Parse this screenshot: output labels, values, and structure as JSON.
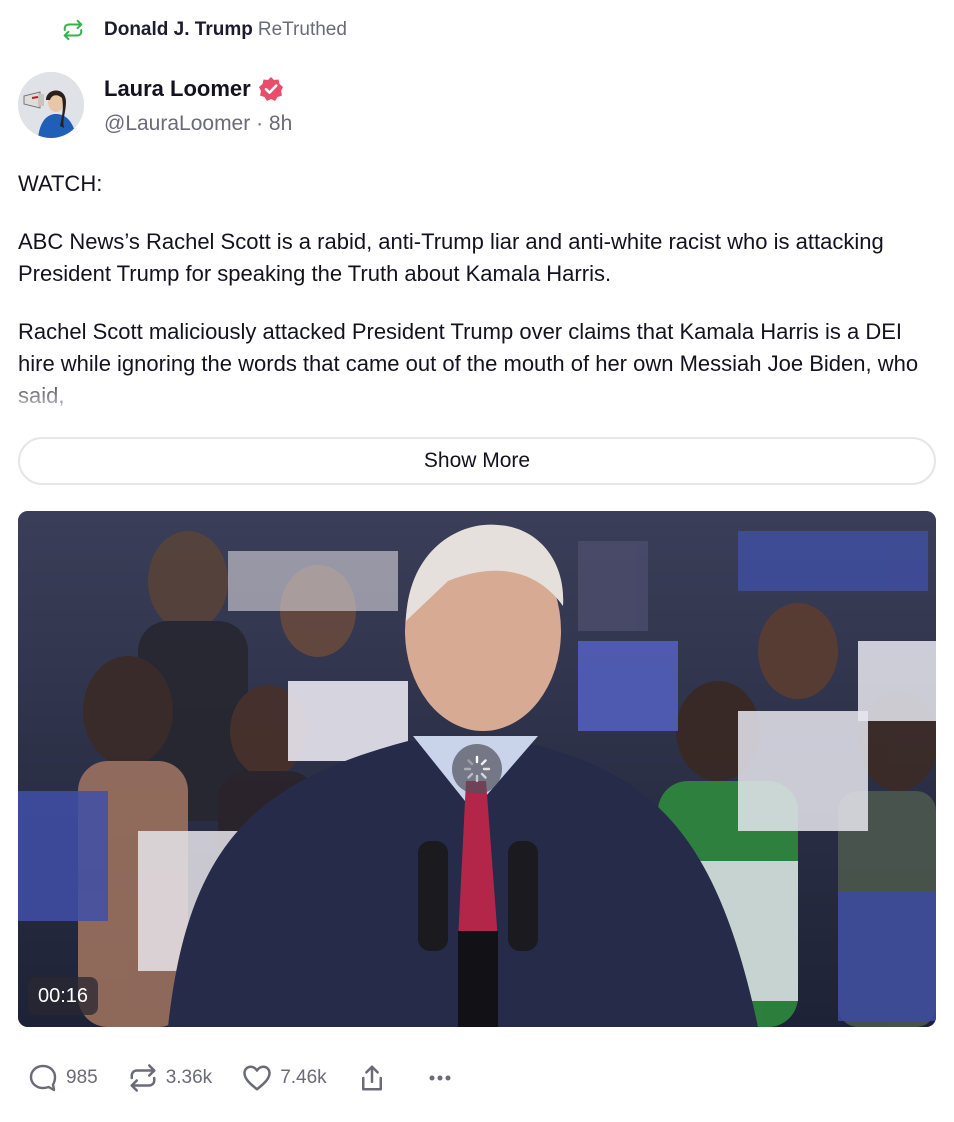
{
  "retruth": {
    "user": "Donald J. Trump",
    "label": "ReTruthed",
    "icon": "retruth-icon",
    "icon_color": "#35b34a"
  },
  "author": {
    "display_name": "Laura Loomer",
    "handle": "@LauraLoomer",
    "separator": "·",
    "time": "8h",
    "verified_icon": "verified-badge-icon",
    "verified_color": "#ea4c6b"
  },
  "post": {
    "paragraphs": [
      "WATCH:",
      "ABC News’s Rachel Scott is a rabid, anti-Trump liar and anti-white racist who is attacking President Trump for speaking the Truth about Kamala Harris.",
      "Rachel Scott maliciously attacked President Trump over claims that Kamala Harris is a DEI hire while ignoring the words that came out of the mouth of her own Messiah Joe Biden, who said,"
    ],
    "show_more_label": "Show More"
  },
  "video": {
    "duration": "00:16",
    "loading_icon": "loading-spinner-icon"
  },
  "actions": {
    "replies": {
      "icon": "reply-icon",
      "count": "985"
    },
    "retruths": {
      "icon": "retruth-icon",
      "count": "3.36k"
    },
    "likes": {
      "icon": "heart-icon",
      "count": "7.46k"
    },
    "share": {
      "icon": "share-icon"
    },
    "more": {
      "icon": "more-icon"
    }
  }
}
